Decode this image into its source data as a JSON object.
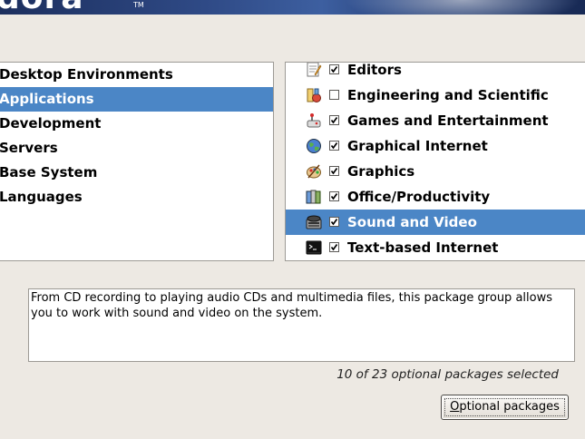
{
  "banner": {
    "logo_text": "dora",
    "tm": "TM"
  },
  "categories": {
    "items": [
      {
        "label": "Desktop Environments",
        "selected": false
      },
      {
        "label": "Applications",
        "selected": true
      },
      {
        "label": "Development",
        "selected": false
      },
      {
        "label": "Servers",
        "selected": false
      },
      {
        "label": "Base System",
        "selected": false
      },
      {
        "label": "Languages",
        "selected": false
      }
    ]
  },
  "groups": {
    "items": [
      {
        "label": "Editors",
        "checked": true,
        "icon": "editors-icon",
        "selected": false
      },
      {
        "label": "Engineering and Scientific",
        "checked": false,
        "icon": "engineering-icon",
        "selected": false
      },
      {
        "label": "Games and Entertainment",
        "checked": true,
        "icon": "games-icon",
        "selected": false
      },
      {
        "label": "Graphical Internet",
        "checked": true,
        "icon": "globe-icon",
        "selected": false
      },
      {
        "label": "Graphics",
        "checked": true,
        "icon": "palette-icon",
        "selected": false
      },
      {
        "label": "Office/Productivity",
        "checked": true,
        "icon": "binders-icon",
        "selected": false
      },
      {
        "label": "Sound and Video",
        "checked": true,
        "icon": "media-icon",
        "selected": true
      },
      {
        "label": "Text-based Internet",
        "checked": true,
        "icon": "terminal-icon",
        "selected": false
      }
    ]
  },
  "description": "From CD recording to playing audio CDs and multimedia files, this package group allows you to work with sound and video on the system.",
  "package_count": "10 of 23 optional packages selected",
  "optional_button": {
    "mnemonic": "O",
    "rest": "ptional packages"
  },
  "colors": {
    "selection": "#4b86c6",
    "background": "#ede9e3"
  }
}
